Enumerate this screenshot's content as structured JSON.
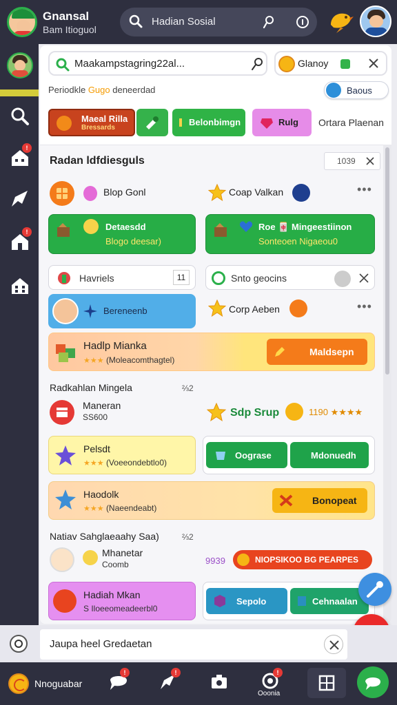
{
  "header": {
    "title": "Gnansal",
    "subtitle": "Bam Itioguol",
    "search_text": "Hadian Sosial"
  },
  "sidebar": {
    "badges": [
      "!",
      "!"
    ]
  },
  "toolbar": {
    "url_value": "Maakampstagring22al...",
    "breadcrumb_prefix": "Periodkle ",
    "breadcrumb_highlight": "Gugo",
    "breadcrumb_suffix": " deneerdad",
    "account_label": "Glanoy",
    "focus_label": "Baous"
  },
  "chips": [
    {
      "label": "Maeal Rilla",
      "sublabel": "Bressards",
      "color": "#c8431e"
    },
    {
      "label": "",
      "color": "#35b24b"
    },
    {
      "label": "Belonbimgn",
      "color": "#2fb346"
    },
    {
      "label": "Rulg",
      "color": "#e68ce8"
    }
  ],
  "chip_trail": "Ortara Plaenan",
  "section": {
    "title": "Radan ldfdiesguls",
    "box_value": "1039"
  },
  "row1": {
    "left_label": "Blop Gonl",
    "right_label": "Coap Valkan"
  },
  "green_cards": [
    {
      "line1": "Detaesdd",
      "line2": "Blogo deesar)"
    },
    {
      "line1": "Roe 🀄 Mingeestiinon",
      "line2": "Sonteoen Nigaeou0"
    }
  ],
  "row3": {
    "left_label": "Havriels",
    "left_box": "11",
    "right_label": "Snto geocins"
  },
  "row4": {
    "blue_label": "Bereneenb",
    "right_label": "Corp Aeben"
  },
  "banner1": {
    "title": "Hadlp Mianka",
    "stars": "★★★",
    "subtitle": "(Moleacomthagtel)",
    "button": "Maldsepn"
  },
  "sub_section1": {
    "title": "Radkahlan Mingela",
    "count": "⅔2",
    "item_title": "Maneran",
    "item_sub": "SS600",
    "right_label": "Sdp Srup",
    "right_num": "1190 ★★★★"
  },
  "banner2": {
    "title": "Pelsdt",
    "stars": "★★★",
    "subtitle": "(Voeeondebtlo0)",
    "btn1": "Oograse",
    "btn2": "Mdonuedh"
  },
  "banner3": {
    "title": "Haodolk",
    "stars": "★★★",
    "subtitle": "(Naeendeabt)",
    "button": "Bonopeat"
  },
  "sub_section2": {
    "title": "Natiav Sahglaeaahy Saa)",
    "count": "⅔2",
    "item_title": "Mhanetar",
    "item_sub": "Coomb",
    "right_num": "9939",
    "right_button": "NIOPSIKOO BG PEARPES"
  },
  "banner4": {
    "title": "Hadiah Mkan",
    "subtitle": "S Iloeeomeadeerbl0",
    "btn1": "Sepolo",
    "btn2": "Cehnaalan"
  },
  "notification": {
    "text": "Jaupa heel Gredaetan"
  },
  "bottom_nav": {
    "label": "Nnoguabar",
    "item4": "Ooonia"
  }
}
